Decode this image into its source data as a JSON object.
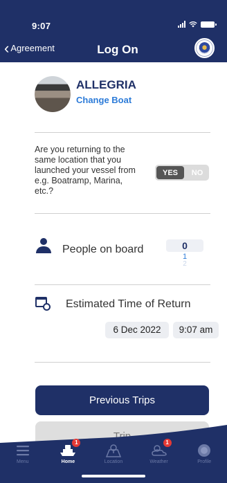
{
  "status": {
    "time": "9:07"
  },
  "nav": {
    "back_label": "Agreement",
    "title": "Log On"
  },
  "boat": {
    "name": "ALLEGRIA",
    "change_label": "Change Boat"
  },
  "return_question": {
    "text": "Are you returning to the same location that you launched your vessel from e.g. Boatramp, Marina, etc.?",
    "yes_label": "YES",
    "no_label": "NO",
    "selected": "YES"
  },
  "people": {
    "label": "People on board",
    "value": "0",
    "next1": "1",
    "next2": "2"
  },
  "eta": {
    "label": "Estimated Time of Return",
    "date": "6 Dec 2022",
    "time": "9:07 am"
  },
  "buttons": {
    "previous_trips": "Previous Trips",
    "next_trip_partial": "Trip"
  },
  "tabbar": {
    "items": [
      {
        "label": "Menu",
        "icon": "menu-icon",
        "active": false
      },
      {
        "label": "Home",
        "icon": "boat-icon",
        "active": true,
        "badge": "1"
      },
      {
        "label": "Location",
        "icon": "map-icon",
        "active": false
      },
      {
        "label": "Weather",
        "icon": "weather-icon",
        "active": false,
        "badge": "1"
      },
      {
        "label": "Profile",
        "icon": "profile-icon",
        "active": false
      }
    ]
  },
  "colors": {
    "primary": "#1f3067",
    "link": "#2c7bd8",
    "badge": "#e53935"
  }
}
